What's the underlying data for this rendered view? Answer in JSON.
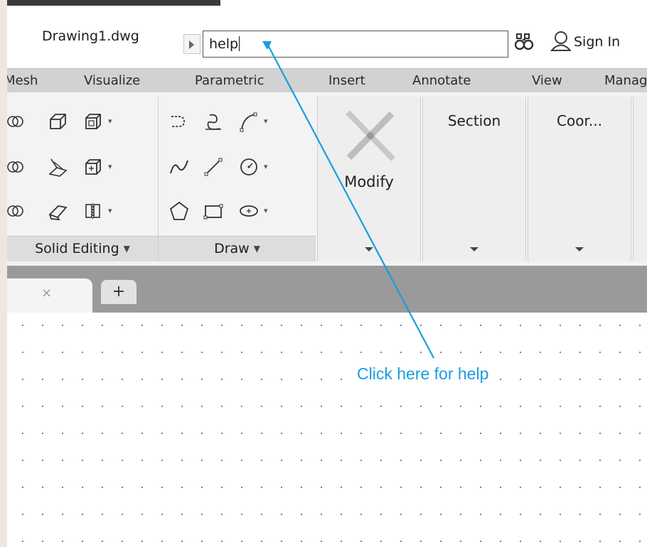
{
  "titlebar": {
    "document_title": "Drawing1.dwg",
    "search_value": "help",
    "sign_in_label": "Sign In"
  },
  "ribbon_tabs": [
    "Mesh",
    "Visualize",
    "Parametric",
    "Insert",
    "Annotate",
    "View",
    "Manage"
  ],
  "panels": {
    "solid_editing": {
      "label": "Solid Editing"
    },
    "draw": {
      "label": "Draw"
    },
    "modify": {
      "label": "Modify"
    },
    "section": {
      "label": "Section"
    },
    "coordinates": {
      "label": "Coor..."
    }
  },
  "file_tabs": {
    "new_tab_label": "+",
    "close_label": "×"
  },
  "callout": {
    "text": "Click here for help",
    "color": "#1a9ce0"
  },
  "colors": {
    "accent": "#1a9ce0",
    "ribbon_bg": "#f3f3f3",
    "tabbar_bg": "#d2d2d2"
  }
}
